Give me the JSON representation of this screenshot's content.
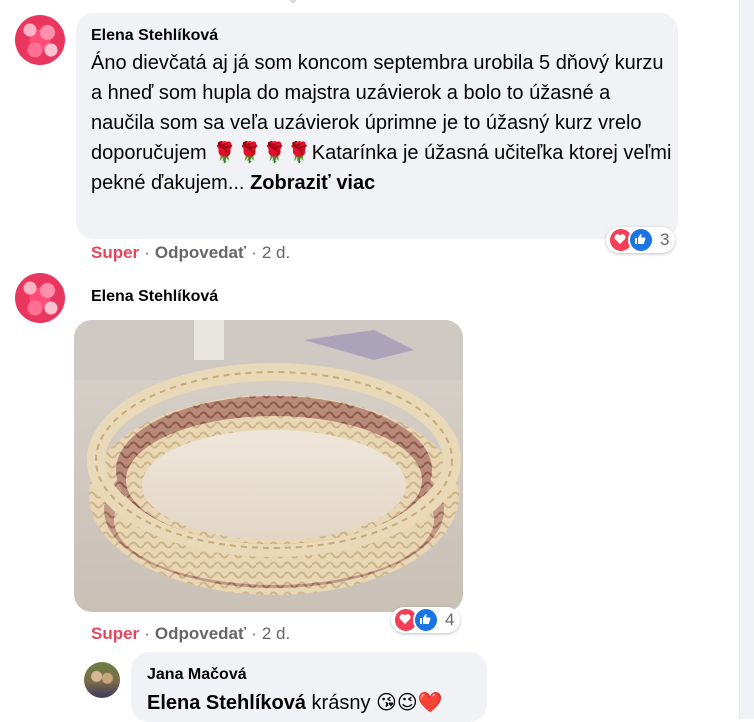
{
  "comments": [
    {
      "author": "Elena Stehlíková",
      "text": "Áno dievčatá aj já som koncom septembra urobila 5 dňový kurzu a hneď som hupla do majstra uzávierok a bolo to úžasné a naučila som sa veľa uzávierok úprimne je to úžasný kurz vrelo doporučujem 🌹🌹🌹🌹Katarínka je úžasná učiteľka ktorej veľmi pekné ďakujem...",
      "see_more": "Zobraziť viac",
      "reaction_label": "Super",
      "reply_label": "Odpovedať",
      "time": "2 d.",
      "reaction_count": "3"
    },
    {
      "author": "Elena Stehlíková",
      "reaction_label": "Super",
      "reply_label": "Odpovedať",
      "time": "2 d.",
      "reaction_count": "4"
    }
  ],
  "reply": {
    "author": "Jana Mačová",
    "mention": "Elena Stehlíková",
    "text": "krásny",
    "emojis": "😘😉❤️"
  },
  "icons": [
    "heart-reaction-icon",
    "like-reaction-icon"
  ],
  "colors": {
    "super": "#e8455c",
    "bubble": "#f0f2f5",
    "like": "#1b74e4",
    "heart": "#f33e58"
  }
}
